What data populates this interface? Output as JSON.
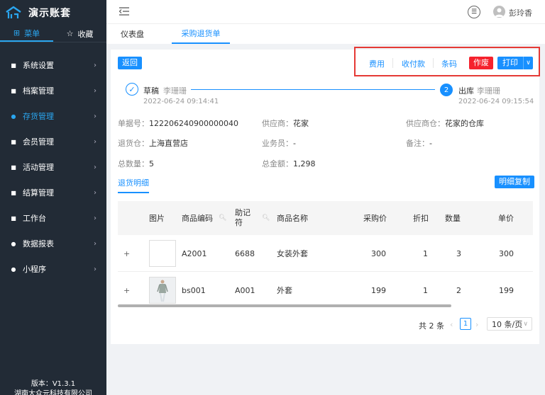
{
  "app": {
    "name": "演示账套"
  },
  "sidebar": {
    "tabs": [
      {
        "label": "菜单",
        "icon": "grid-icon"
      },
      {
        "label": "收藏",
        "icon": "star-icon"
      }
    ],
    "menu": [
      {
        "label": "系统设置",
        "icon": "settings-icon"
      },
      {
        "label": "档案管理",
        "icon": "archive-icon"
      },
      {
        "label": "存货管理",
        "icon": "inventory-icon"
      },
      {
        "label": "会员管理",
        "icon": "member-icon"
      },
      {
        "label": "活动管理",
        "icon": "gift-icon"
      },
      {
        "label": "结算管理",
        "icon": "settlement-icon"
      },
      {
        "label": "工作台",
        "icon": "workbench-icon"
      },
      {
        "label": "数据报表",
        "icon": "report-icon"
      },
      {
        "label": "小程序",
        "icon": "miniapp-icon"
      }
    ],
    "version": "版本：V1.3.1",
    "company": "湖南大众元科技有限公司"
  },
  "topbar": {
    "username": "彭玲香"
  },
  "page_tabs": [
    {
      "label": "仪表盘"
    },
    {
      "label": "采购退货单"
    }
  ],
  "toolbar": {
    "back": "返回",
    "fee": "费用",
    "payment": "收付款",
    "barcode": "条码",
    "void": "作废",
    "print": "打印"
  },
  "steps": [
    {
      "title": "草稿",
      "user": "李珊珊",
      "time": "2022-06-24 09:14:41"
    },
    {
      "index": "2",
      "title": "出库",
      "user": "李珊珊",
      "time": "2022-06-24 09:15:54"
    }
  ],
  "info": {
    "doc_no": {
      "k": "单据号：",
      "v": "122206240900000040"
    },
    "supplier": {
      "k": "供应商：",
      "v": "花家"
    },
    "supplier_wh": {
      "k": "供应商仓：",
      "v": "花家的仓库"
    },
    "return_wh": {
      "k": "退货仓：",
      "v": "上海直营店"
    },
    "salesman": {
      "k": "业务员：",
      "v": "-"
    },
    "remark": {
      "k": "备注：",
      "v": "-"
    },
    "total_qty": {
      "k": "总数量：",
      "v": "5"
    },
    "total_amount": {
      "k": "总金额：",
      "v": "1,298"
    }
  },
  "detail": {
    "tab": "退货明细",
    "copy": "明细复制"
  },
  "table": {
    "headers": {
      "image": "图片",
      "code": "商品编码",
      "mnemonic": "助记符",
      "name": "商品名称",
      "price": "采购价",
      "discount": "折扣",
      "qty": "数量",
      "unit": "单价"
    },
    "rows": [
      {
        "code": "A2001",
        "mnemonic": "6688",
        "name": "女装外套",
        "price": "300",
        "discount": "1",
        "qty": "3",
        "unit": "300"
      },
      {
        "code": "bs001",
        "mnemonic": "A001",
        "name": "外套",
        "price": "199",
        "discount": "1",
        "qty": "2",
        "unit": "199"
      }
    ]
  },
  "pagination": {
    "total": "共 2 条",
    "page": "1",
    "size": "10 条/页"
  }
}
